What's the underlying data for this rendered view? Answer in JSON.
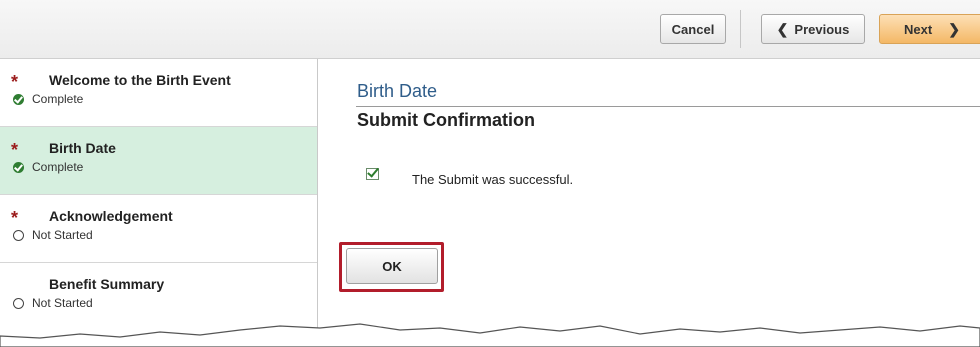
{
  "header": {
    "cancel_label": "Cancel",
    "previous_label": "Previous",
    "next_label": "Next"
  },
  "sidebar": {
    "steps": [
      {
        "title": "Welcome to the Birth Event",
        "status": "Complete",
        "required": true,
        "state": "complete"
      },
      {
        "title": "Birth Date",
        "status": "Complete",
        "required": true,
        "state": "complete",
        "active": true
      },
      {
        "title": "Acknowledgement",
        "status": "Not Started",
        "required": true,
        "state": "not-started"
      },
      {
        "title": "Benefit Summary",
        "status": "Not Started",
        "required": false,
        "state": "not-started"
      }
    ]
  },
  "main": {
    "page_title": "Birth Date",
    "section_title": "Submit Confirmation",
    "message": "The Submit was successful.",
    "ok_label": "OK"
  },
  "colors": {
    "active_step_bg": "#d6efdf",
    "title_blue": "#2f5d8a",
    "required_star": "#9b1b1b",
    "highlight_red": "#b21d2b",
    "next_button": "#f4b866"
  },
  "icons": {
    "required": "asterisk-icon",
    "complete": "check-circle-icon",
    "not_started": "empty-circle-icon",
    "success": "checkbox-check-icon"
  }
}
